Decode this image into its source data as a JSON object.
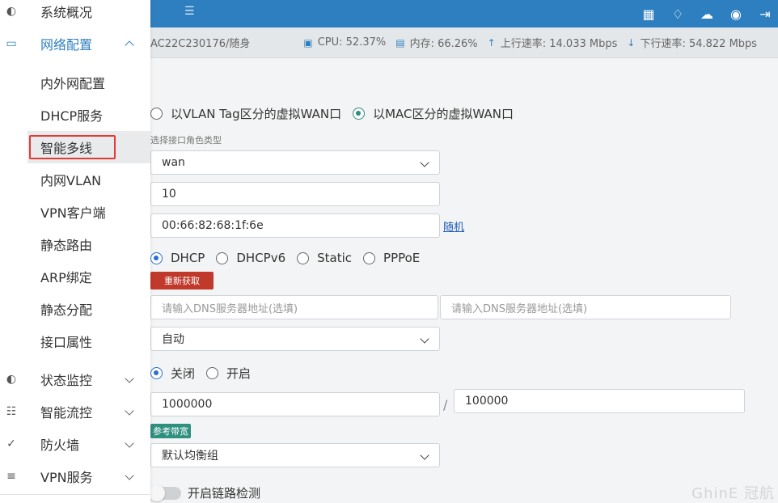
{
  "header": {
    "menu_icon": "menu-icon",
    "icons": [
      "qrcode-icon",
      "bell-icon",
      "cloud-icon",
      "globe-icon",
      "logout-icon"
    ]
  },
  "status": {
    "device": "AC22C230176/随身",
    "cpu": "CPU: 52.37%",
    "mem": "内存: 66.26%",
    "up": "上行速率: 14.033 Mbps",
    "down": "下行速率: 54.822 Mbps"
  },
  "sidebar": {
    "top_partial": "系统概况",
    "network": "网络配置",
    "sub_items": [
      "内外网配置",
      "DHCP服务",
      "智能多线",
      "内网VLAN",
      "VPN客户端",
      "静态路由",
      "ARP绑定",
      "静态分配",
      "接口属性"
    ],
    "sections": [
      "状态监控",
      "智能流控",
      "防火墙",
      "VPN服务"
    ]
  },
  "form": {
    "wan_mode": {
      "opt1": "以VLAN Tag区分的虚拟WAN口",
      "opt2": "以MAC区分的虚拟WAN口"
    },
    "role_label": "选择接口角色类型",
    "role_value": "wan",
    "vlan_value": "10",
    "mac_value": "00:66:82:68:1f:6e",
    "random_link": "随机",
    "proto": {
      "dhcp": "DHCP",
      "dhcpv6": "DHCPv6",
      "static": "Static",
      "pppoe": "PPPoE"
    },
    "renew_btn": "重新获取",
    "dns1_ph": "请输入DNS服务器地址(选填)",
    "dns2_ph": "请输入DNS服务器地址(选填)",
    "mtu_select": "自动",
    "switch": {
      "off": "关闭",
      "on": "开启"
    },
    "bw_up": "1000000",
    "bw_down": "100000",
    "ref_btn": "参考带宽",
    "group_select": "默认均衡组",
    "link_detect": "开启链路检测"
  },
  "watermark": "GhinE 冠航"
}
